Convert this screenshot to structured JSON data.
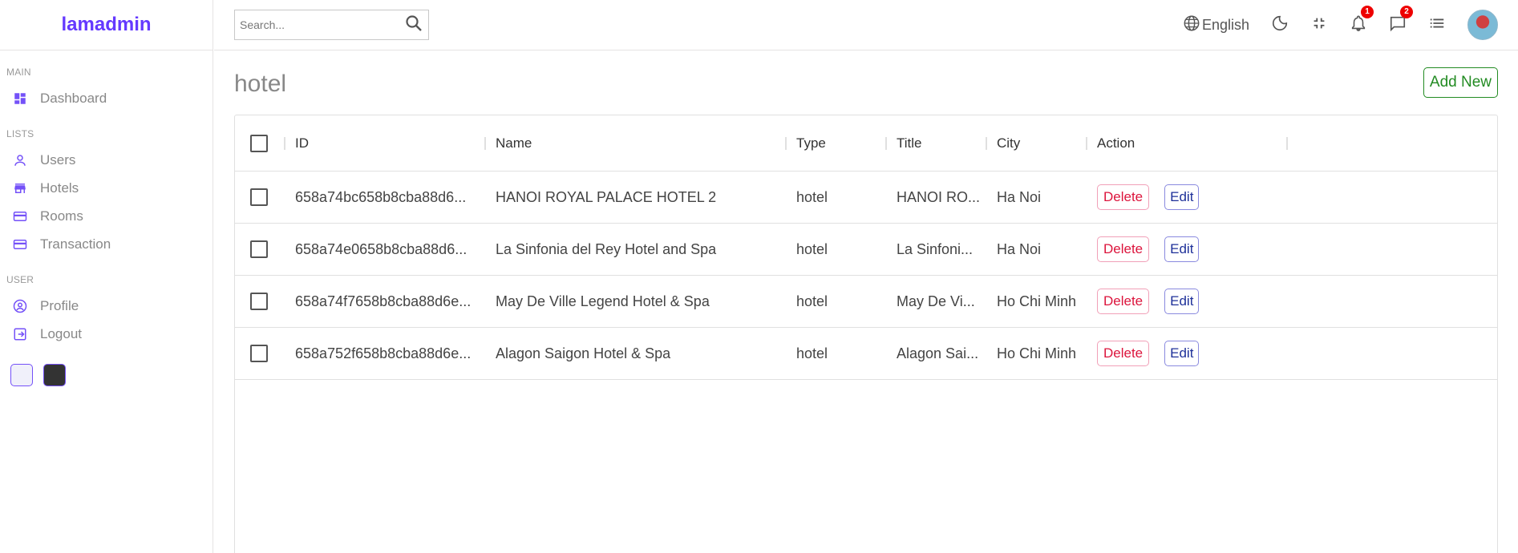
{
  "app": {
    "logo": "lamadmin"
  },
  "sidebar": {
    "sections": [
      {
        "title": "MAIN",
        "items": [
          {
            "label": "Dashboard",
            "icon": "dashboard-icon"
          }
        ]
      },
      {
        "title": "LISTS",
        "items": [
          {
            "label": "Users",
            "icon": "user-icon"
          },
          {
            "label": "Hotels",
            "icon": "store-icon"
          },
          {
            "label": "Rooms",
            "icon": "credit-card-icon"
          },
          {
            "label": "Transaction",
            "icon": "credit-card-icon"
          }
        ]
      },
      {
        "title": "USER",
        "items": [
          {
            "label": "Profile",
            "icon": "account-circle-icon"
          },
          {
            "label": "Logout",
            "icon": "logout-icon"
          }
        ]
      }
    ],
    "color_options": [
      "#f0f0fa",
      "#333333"
    ]
  },
  "navbar": {
    "search_placeholder": "Search...",
    "language": "English",
    "notifications_count": "1",
    "messages_count": "2"
  },
  "page": {
    "title": "hotel",
    "add_new_label": "Add New"
  },
  "table": {
    "columns": [
      "ID",
      "Name",
      "Type",
      "Title",
      "City",
      "Action"
    ],
    "delete_label": "Delete",
    "edit_label": "Edit",
    "rows": [
      {
        "id": "658a74bc658b8cba88d6...",
        "name": "HANOI ROYAL PALACE HOTEL 2",
        "type": "hotel",
        "title": "HANOI RO...",
        "city": "Ha Noi"
      },
      {
        "id": "658a74e0658b8cba88d6...",
        "name": "La Sinfonia del Rey Hotel and Spa",
        "type": "hotel",
        "title": "La Sinfoni...",
        "city": "Ha Noi"
      },
      {
        "id": "658a74f7658b8cba88d6e...",
        "name": "May De Ville Legend Hotel & Spa",
        "type": "hotel",
        "title": "May De Vi...",
        "city": "Ho Chi Minh"
      },
      {
        "id": "658a752f658b8cba88d6e...",
        "name": "Alagon Saigon Hotel & Spa",
        "type": "hotel",
        "title": "Alagon Sai...",
        "city": "Ho Chi Minh"
      }
    ]
  },
  "colors": {
    "accent": "#6439ff",
    "add_new": "#228b22",
    "delete": "#dc143c",
    "edit": "#1e3099"
  }
}
